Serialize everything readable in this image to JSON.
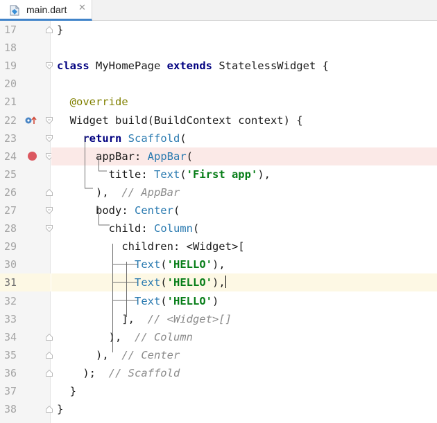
{
  "tab": {
    "file_name": "main.dart",
    "close_glyph": "✕",
    "icon": "dart-file-icon"
  },
  "colors": {
    "keyword": "#000080",
    "class_ref": "#2a7ab0",
    "string": "#067d17",
    "comment": "#8c8c8c",
    "annotation": "#808000",
    "breakpoint": "#db5860",
    "current_line": "#fdf8e4"
  },
  "lines": [
    {
      "number": "17",
      "fold": "up",
      "tokens": [
        {
          "t": "}",
          "c": "plain"
        }
      ]
    },
    {
      "number": "18",
      "fold": "",
      "tokens": []
    },
    {
      "number": "19",
      "fold": "down",
      "tokens": [
        {
          "t": "class",
          "c": "kw"
        },
        {
          "t": " MyHomePage ",
          "c": "plain"
        },
        {
          "t": "extends",
          "c": "kw"
        },
        {
          "t": " StatelessWidget {",
          "c": "plain"
        }
      ]
    },
    {
      "number": "20",
      "fold": "",
      "tokens": []
    },
    {
      "number": "21",
      "fold": "",
      "tokens": [
        {
          "t": "  ",
          "c": "plain"
        },
        {
          "t": "@override",
          "c": "ann"
        }
      ]
    },
    {
      "number": "22",
      "fold": "down",
      "marker": "override",
      "tokens": [
        {
          "t": "  Widget build(BuildContext context) {",
          "c": "plain"
        }
      ]
    },
    {
      "number": "23",
      "fold": "down",
      "tokens": [
        {
          "t": "    ",
          "c": "plain"
        },
        {
          "t": "return",
          "c": "kw"
        },
        {
          "t": " ",
          "c": "plain"
        },
        {
          "t": "Scaffold",
          "c": "cls"
        },
        {
          "t": "(",
          "c": "plain"
        }
      ]
    },
    {
      "number": "24",
      "fold": "down",
      "marker": "breakpoint",
      "tokens": [
        {
          "t": "      appBar: ",
          "c": "plain"
        },
        {
          "t": "AppBar",
          "c": "cls"
        },
        {
          "t": "(",
          "c": "plain"
        }
      ]
    },
    {
      "number": "25",
      "fold": "",
      "tokens": [
        {
          "t": "        title: ",
          "c": "plain"
        },
        {
          "t": "Text",
          "c": "cls"
        },
        {
          "t": "(",
          "c": "plain"
        },
        {
          "t": "'First app'",
          "c": "str"
        },
        {
          "t": "),",
          "c": "plain"
        }
      ]
    },
    {
      "number": "26",
      "fold": "up",
      "tokens": [
        {
          "t": "      ),  ",
          "c": "plain"
        },
        {
          "t": "// AppBar",
          "c": "cmt"
        }
      ]
    },
    {
      "number": "27",
      "fold": "down",
      "tokens": [
        {
          "t": "      body: ",
          "c": "plain"
        },
        {
          "t": "Center",
          "c": "cls"
        },
        {
          "t": "(",
          "c": "plain"
        }
      ]
    },
    {
      "number": "28",
      "fold": "down",
      "tokens": [
        {
          "t": "        child: ",
          "c": "plain"
        },
        {
          "t": "Column",
          "c": "cls"
        },
        {
          "t": "(",
          "c": "plain"
        }
      ]
    },
    {
      "number": "29",
      "fold": "",
      "tokens": [
        {
          "t": "          children: <Widget>[",
          "c": "plain"
        }
      ]
    },
    {
      "number": "30",
      "fold": "",
      "tokens": [
        {
          "t": "            ",
          "c": "plain"
        },
        {
          "t": "Text",
          "c": "cls"
        },
        {
          "t": "(",
          "c": "plain"
        },
        {
          "t": "'HELLO'",
          "c": "str"
        },
        {
          "t": "),",
          "c": "plain"
        }
      ]
    },
    {
      "number": "31",
      "fold": "",
      "current": true,
      "tokens": [
        {
          "t": "            ",
          "c": "plain"
        },
        {
          "t": "Text",
          "c": "cls"
        },
        {
          "t": "(",
          "c": "plain"
        },
        {
          "t": "'HELLO'",
          "c": "str"
        },
        {
          "t": "),",
          "c": "plain"
        }
      ]
    },
    {
      "number": "32",
      "fold": "",
      "tokens": [
        {
          "t": "            ",
          "c": "plain"
        },
        {
          "t": "Text",
          "c": "cls"
        },
        {
          "t": "(",
          "c": "plain"
        },
        {
          "t": "'HELLO'",
          "c": "str"
        },
        {
          "t": ")",
          "c": "plain"
        }
      ]
    },
    {
      "number": "33",
      "fold": "",
      "tokens": [
        {
          "t": "          ],  ",
          "c": "plain"
        },
        {
          "t": "// <Widget>[]",
          "c": "cmt"
        }
      ]
    },
    {
      "number": "34",
      "fold": "up",
      "tokens": [
        {
          "t": "        ),  ",
          "c": "plain"
        },
        {
          "t": "// Column",
          "c": "cmt"
        }
      ]
    },
    {
      "number": "35",
      "fold": "up",
      "tokens": [
        {
          "t": "      ),  ",
          "c": "plain"
        },
        {
          "t": "// Center",
          "c": "cmt"
        }
      ]
    },
    {
      "number": "36",
      "fold": "up",
      "tokens": [
        {
          "t": "    );  ",
          "c": "plain"
        },
        {
          "t": "// Scaffold",
          "c": "cmt"
        }
      ]
    },
    {
      "number": "37",
      "fold": "",
      "tokens": [
        {
          "t": "  }",
          "c": "plain"
        }
      ]
    },
    {
      "number": "38",
      "fold": "up",
      "tokens": [
        {
          "t": "}",
          "c": "plain"
        }
      ]
    }
  ]
}
